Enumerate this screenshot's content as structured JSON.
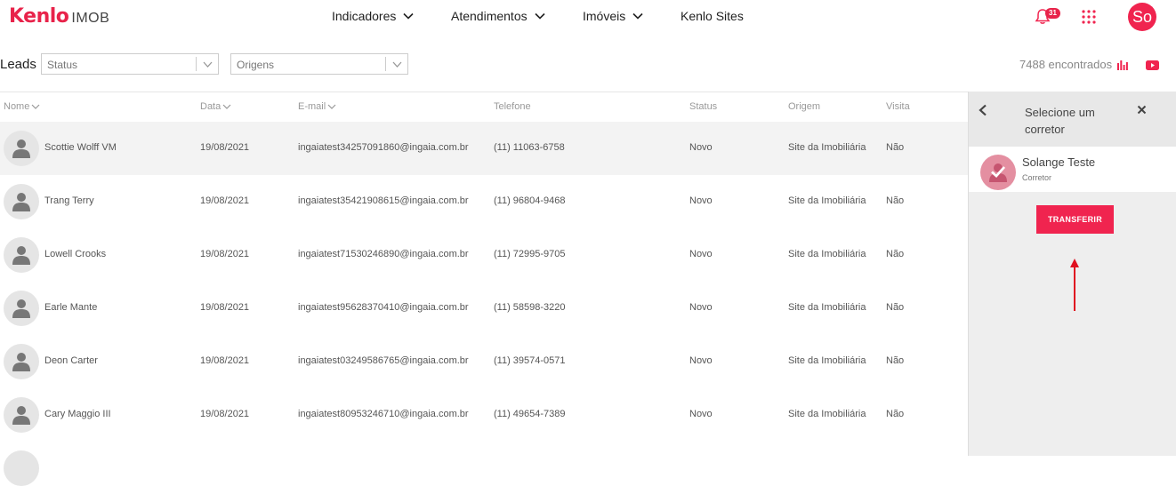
{
  "brand": {
    "name": "Kenlo",
    "product": "IMOB",
    "accent": "#f0244f"
  },
  "nav": [
    {
      "label": "Indicadores",
      "has_dropdown": true
    },
    {
      "label": "Atendimentos",
      "has_dropdown": true
    },
    {
      "label": "Imóveis",
      "has_dropdown": true
    },
    {
      "label": "Kenlo Sites",
      "has_dropdown": false
    }
  ],
  "header_right": {
    "notification_count": "31",
    "user_initials": "So"
  },
  "filters": {
    "title": "Leads",
    "status_placeholder": "Status",
    "origins_placeholder": "Origens",
    "found_text": "7488 encontrados"
  },
  "table": {
    "columns": [
      "Nome",
      "Data",
      "E-mail",
      "Telefone",
      "Status",
      "Origem",
      "Visita"
    ],
    "rows": [
      {
        "name": "Scottie Wolff VM",
        "date": "19/08/2021",
        "email": "ingaiatest34257091860@ingaia.com.br",
        "phone": "(11) 11063-6758",
        "status": "Novo",
        "origin": "Site da Imobiliária",
        "visit": "Não",
        "selected": true
      },
      {
        "name": "Trang Terry",
        "date": "19/08/2021",
        "email": "ingaiatest35421908615@ingaia.com.br",
        "phone": "(11) 96804-9468",
        "status": "Novo",
        "origin": "Site da Imobiliária",
        "visit": "Não"
      },
      {
        "name": "Lowell Crooks",
        "date": "19/08/2021",
        "email": "ingaiatest71530246890@ingaia.com.br",
        "phone": "(11) 72995-9705",
        "status": "Novo",
        "origin": "Site da Imobiliária",
        "visit": "Não"
      },
      {
        "name": "Earle Mante",
        "date": "19/08/2021",
        "email": "ingaiatest95628370410@ingaia.com.br",
        "phone": "(11) 58598-3220",
        "status": "Novo",
        "origin": "Site da Imobiliária",
        "visit": "Não"
      },
      {
        "name": "Deon Carter",
        "date": "19/08/2021",
        "email": "ingaiatest03249586765@ingaia.com.br",
        "phone": "(11) 39574-0571",
        "status": "Novo",
        "origin": "Site da Imobiliária",
        "visit": "Não"
      },
      {
        "name": "Cary Maggio III",
        "date": "19/08/2021",
        "email": "ingaiatest80953246710@ingaia.com.br",
        "phone": "(11) 49654-7389",
        "status": "Novo",
        "origin": "Site da Imobiliária",
        "visit": "Não"
      }
    ]
  },
  "panel": {
    "title": "Selecione um corretor",
    "agent_name": "Solange Teste",
    "agent_role": "Corretor",
    "transfer_label": "TRANSFERIR"
  }
}
